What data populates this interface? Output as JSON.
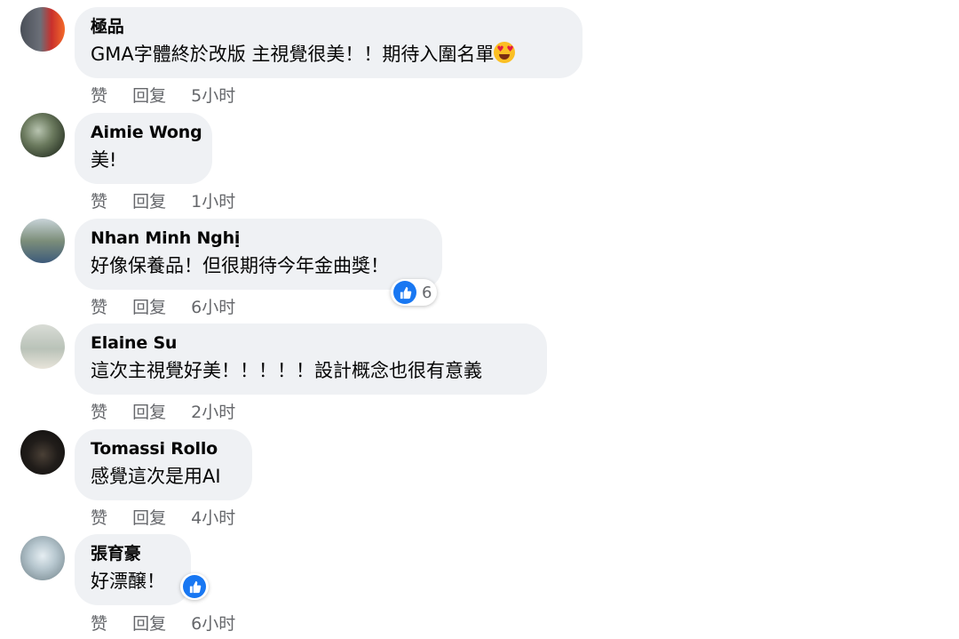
{
  "colors": {
    "bubble": "#eff1f4",
    "meta": "#65676b",
    "like": "#1877f2"
  },
  "labels": {
    "like": "赞",
    "reply": "回复"
  },
  "comments": [
    {
      "author": "極品",
      "text": "GMA字體終於改版 主視覺很美！！期待入圍名單",
      "emoji_icon": "heart-eyes-emoji-icon",
      "time": "5小时"
    },
    {
      "author": "Aimie Wong",
      "text": "美!",
      "time": "1小时"
    },
    {
      "author": "Nhan Minh Nghị",
      "text": "好像保養品！但很期待今年金曲獎！",
      "time": "6小时",
      "reactions": "6"
    },
    {
      "author": "Elaine Su",
      "text": "這次主視覺好美！！！！！設計概念也很有意義",
      "time": "2小时"
    },
    {
      "author": "Tomassi Rollo",
      "text": "感覺這次是用AI",
      "time": "4小时"
    },
    {
      "author": "張育豪",
      "text": "好漂醸！",
      "time": "6小时",
      "reaction_icon": "like-icon"
    }
  ]
}
